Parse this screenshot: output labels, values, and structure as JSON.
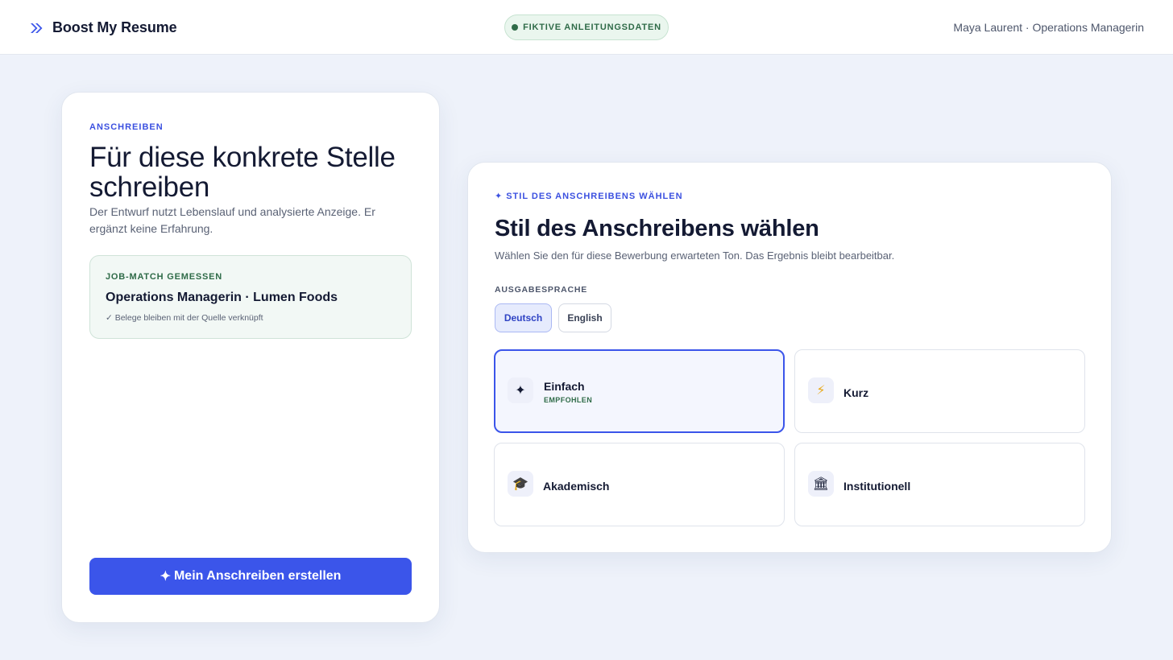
{
  "header": {
    "brand_name": "Boost My Resume",
    "brand_icon": "double-chevron-right-icon",
    "demo_badge": "FIKTIVE ANLEITUNGSDATEN",
    "user_line": "Maya Laurent · Operations Managerin"
  },
  "left_panel": {
    "eyebrow": "ANSCHREIBEN",
    "title": "Für diese konkrete Stelle schreiben",
    "subtitle": "Der Entwurf nutzt Lebenslauf und analysierte Anzeige. Er ergänzt keine Erfahrung.",
    "match": {
      "eyebrow": "JOB-MATCH GEMESSEN",
      "title": "Operations Managerin · Lumen Foods",
      "note": "✓ Belege bleiben mit der Quelle verknüpft"
    },
    "cta": {
      "icon": "✦",
      "label": "Mein Anschreiben erstellen"
    }
  },
  "style_picker": {
    "eyebrow_icon": "✦",
    "eyebrow": "STIL DES ANSCHREIBENS WÄHLEN",
    "title": "Stil des Anschreibens wählen",
    "subtitle": "Wählen Sie den für diese Bewerbung erwarteten Ton. Das Ergebnis bleibt bearbeitbar.",
    "language_label": "AUSGABESPRACHE",
    "languages": [
      "Deutsch",
      "English"
    ],
    "selected_language": "Deutsch",
    "options": [
      {
        "label": "Einfach",
        "icon": "✦",
        "badge": "EMPFOHLEN",
        "selected": true
      },
      {
        "label": "Kurz",
        "icon": "⚡",
        "badge": "",
        "selected": false
      },
      {
        "label": "Akademisch",
        "icon": "🎓",
        "badge": "",
        "selected": false
      },
      {
        "label": "Institutionell",
        "icon": "🏛",
        "badge": "",
        "selected": false
      }
    ]
  },
  "colors": {
    "accent": "#3b55ea",
    "success": "#2f6b48",
    "page_background": "#eef2fa"
  }
}
